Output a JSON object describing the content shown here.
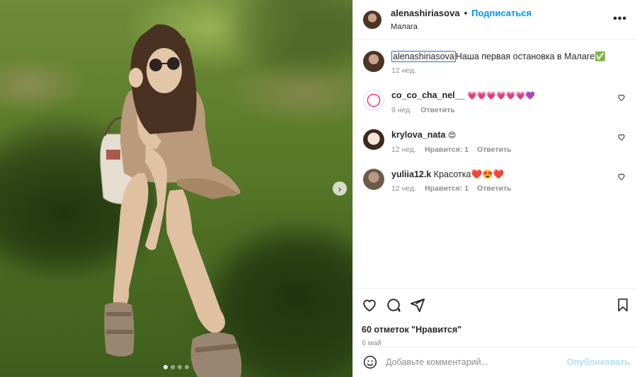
{
  "photo": {
    "alt": "",
    "dots_count": 4,
    "active_dot": 1
  },
  "post": {
    "author": "alenashiriasova",
    "follow_label": "Подписаться",
    "separator": "•",
    "location": "Малага",
    "more_label": "•••"
  },
  "caption": {
    "user": "alenashiriasova",
    "text": "Наша первая остановка в Малаге✅",
    "time": "12 нед."
  },
  "comments": [
    {
      "user": "co_co_cha_nel__",
      "text": "💗💗💗💗💗💗💜",
      "time": "9 нед.",
      "likes": "",
      "reply": "Ответить"
    },
    {
      "user": "krylova_nata",
      "text": "😍",
      "time": "12 нед.",
      "likes": "Нравится: 1",
      "reply": "Ответить"
    },
    {
      "user": "yuliia12.k",
      "text": "Красотка❤️😍❤️",
      "time": "12 нед.",
      "likes": "Нравится: 1",
      "reply": "Ответить"
    }
  ],
  "stats": {
    "likes": "60 отметок \"Нравится\"",
    "date": "6 май"
  },
  "comment_box": {
    "placeholder": "Добавьте комментарий...",
    "post_label": "Опубликовать"
  },
  "colors": {
    "accent": "#0095f6",
    "muted": "#8e8e8e",
    "text": "#262626",
    "post_disabled": "#b2dffc"
  }
}
